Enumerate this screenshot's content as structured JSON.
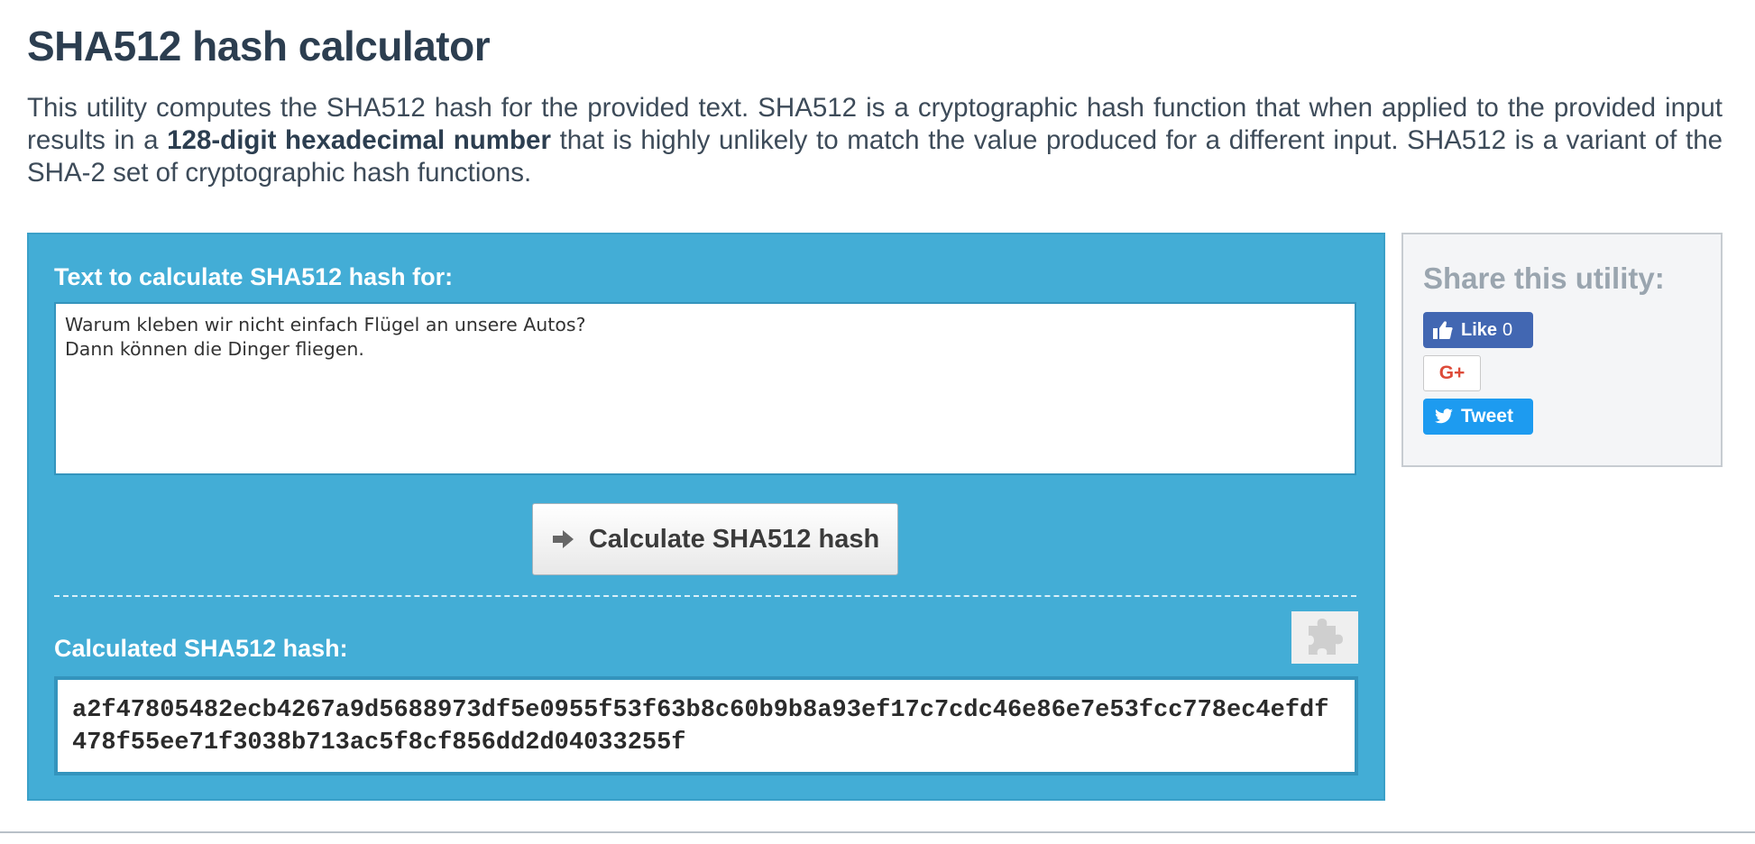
{
  "page": {
    "title": "SHA512 hash calculator",
    "intro": {
      "part1": "This utility computes the SHA512 hash for the provided text. SHA512 is a cryptographic hash function that when applied to the provided input results in a ",
      "bold": "128-digit hexadecimal number",
      "part2": " that is highly unlikely to match the value produced for a different input. SHA512 is a variant of the SHA-2 set of cryptographic hash functions."
    }
  },
  "calculator": {
    "input_label": "Text to calculate SHA512 hash for:",
    "input_value": "Warum kleben wir nicht einfach Flügel an unsere Autos?\nDann können die Dinger fliegen.",
    "button_label": "Calculate SHA512 hash",
    "button_icon": "arrow-right-icon",
    "output_label": "Calculated SHA512 hash:",
    "output_value": "a2f47805482ecb4267a9d5688973df5e0955f53f63b8c60b9b8a93ef17c7cdc46e86e7e53fcc778ec4efdf478f55ee71f3038b713ac5f8cf856dd2d04033255f",
    "plugin_icon": "puzzle-icon"
  },
  "share": {
    "title": "Share this utility:",
    "like_label": "Like",
    "like_count": "0",
    "gplus_label": "G+",
    "tweet_label": "Tweet"
  },
  "colors": {
    "panel_bg": "#43add6",
    "facebook": "#4267b2",
    "twitter": "#1d9bf0",
    "gplus": "#dd4b39",
    "heading": "#2c3e50"
  }
}
